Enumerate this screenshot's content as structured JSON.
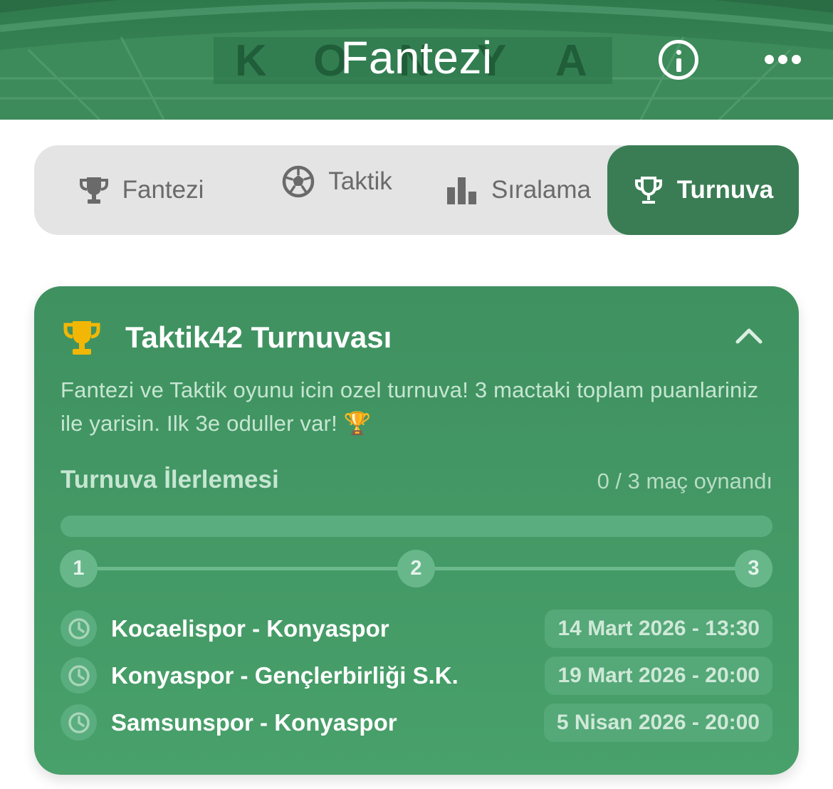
{
  "header": {
    "title": "Fantezi",
    "stadium_sign": "KONYA",
    "info_icon": "info-circle-icon",
    "more_icon": "more-dots-icon"
  },
  "tabs": [
    {
      "label": "Fantezi",
      "icon": "trophy-icon",
      "active": false
    },
    {
      "label": "Taktik",
      "icon": "soccer-ball-icon",
      "active": false
    },
    {
      "label": "Sıralama",
      "icon": "bar-chart-icon",
      "active": false
    },
    {
      "label": "Turnuva",
      "icon": "trophy-outline-icon",
      "active": true
    }
  ],
  "tournament": {
    "title": "Taktik42 Turnuvası",
    "icon": "gold-trophy-icon",
    "collapse_icon": "chevron-up-icon",
    "description": "Fantezi ve Taktik oyunu icin ozel turnuva! 3 mactaki toplam puanlariniz ile yarisin. Ilk 3e oduller var! 🏆",
    "progress_title": "Turnuva İlerlemesi",
    "progress_text": "0 / 3 maç oynandı",
    "progress_fraction": 0,
    "steps": [
      "1",
      "2",
      "3"
    ],
    "matches": [
      {
        "teams": "Kocaelispor - Konyaspor",
        "date": "14 Mart 2026 - 13:30"
      },
      {
        "teams": "Konyaspor - Gençlerbirliği S.K.",
        "date": "19 Mart 2026 - 20:00"
      },
      {
        "teams": "Samsunspor - Konyaspor",
        "date": "5 Nisan 2026 - 20:00"
      }
    ]
  },
  "colors": {
    "brand_green": "#3a7d54",
    "card_green": "#44995f",
    "gold": "#f2b705"
  }
}
